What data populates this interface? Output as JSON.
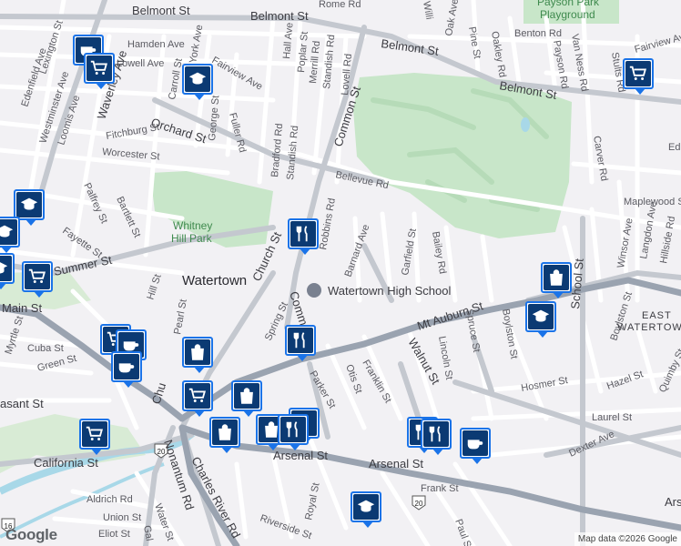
{
  "map": {
    "streets": {
      "belmont_w": "Belmont St",
      "belmont_e": "Belmont St",
      "belmont_e2": "Belmont St",
      "rome_rd": "Rome Rd",
      "hamden": "Hamden Ave",
      "york": "York Ave",
      "hall": "Hall Ave",
      "poplar": "Poplar St",
      "merrill": "Merrill Rd",
      "standish_top": "Standish Rd",
      "lovell_rd": "Lovell Rd",
      "lexington": "Lexington St",
      "edenfield": "Edenfield Ave",
      "lowell": "Lowell Ave",
      "westminster": "Westminster Ave",
      "loomis": "Loomis Ave",
      "waverley": "Waverley Ave",
      "carroll": "Carroll St",
      "fairview": "Fairview Ave",
      "george": "George St",
      "fuller": "Fuller Rd",
      "orchard": "Orchard St",
      "fitchburg": "Fitchburg St",
      "worcester": "Worcester St",
      "bradford": "Bradford Rd",
      "standish": "Standish Rd",
      "common": "Common St",
      "bellevue": "Bellevue Rd",
      "palfrey": "Palfrey St",
      "bartlett": "Bartlett St",
      "fayette": "Fayette St",
      "summer": "Summer St",
      "hill": "Hill St",
      "main": "Main St",
      "myrtle": "Myrtle St",
      "cuba": "Cuba St",
      "green": "Green St",
      "pearl": "Pearl St",
      "church": "Church St",
      "church2": "Church St",
      "spring": "Spring St",
      "common2": "Common St",
      "robbins": "Robbins Rd",
      "barnard": "Barnard Ave",
      "garfield": "Garfield St",
      "bailey": "Bailey Rd",
      "mt_auburn": "Mt Auburn St",
      "walnut": "Walnut St",
      "lincoln": "Lincoln St",
      "spruce": "Spruce St",
      "boylston": "Boylston St",
      "boylston2": "Boylston St",
      "school": "School St",
      "otis": "Otis St",
      "franklin": "Franklin St",
      "parker": "Parker St",
      "pleasant": "Pleasant St",
      "california": "California St",
      "nonantum": "Nonantum Rd",
      "charles_river": "Charles River Rd",
      "arsenal_w": "Arsenal St",
      "arsenal_e": "Arsenal St",
      "arsenal_e2": "Arsenal St",
      "frank": "Frank St",
      "aldrich": "Aldrich Rd",
      "water": "Water St",
      "union": "Union St",
      "eliot": "Eliot St",
      "royal": "Royal St",
      "riverside": "Riverside St",
      "paul": "Paul St",
      "hosmer": "Hosmer St",
      "hazel": "Hazel St",
      "laurel": "Laurel St",
      "dexter": "Dexter Ave",
      "quimby": "Quimby St",
      "carver": "Carver Rd",
      "winsor": "Winsor Ave",
      "langdon": "Langdon Ave",
      "hillside": "Hillside Rd",
      "maplewood": "Maplewood St",
      "oak": "Oak Ave",
      "pine": "Pine St",
      "oakley": "Oakley Rd",
      "benton": "Benton Rd",
      "van_ness": "Van Ness Rd",
      "payson": "Payson Rd",
      "stults": "Stults Rd",
      "fairview_e": "Fairview Ave",
      "edge_ed": "Ed",
      "will": "Willi",
      "gal": "Gal",
      "royal_st_short": "Royal St",
      "sp": "Sp",
      "chu": "Chu",
      "pleasant_short": "asant St",
      "wb": "S"
    },
    "places": {
      "town": "Watertown",
      "park": "Whitney Hill Park",
      "park_line1": "Whitney",
      "park_line2": "Hill Park",
      "payson_line1": "Payson Park",
      "payson_line2": "Playground",
      "high_school": "Watertown High School",
      "east_line1": "EAST",
      "east_line2": "WATERTOWN"
    },
    "shields": {
      "r20a": "20",
      "r20b": "20",
      "r16": "16"
    },
    "logo": "Google",
    "attribution": "Map data ©2026 Google",
    "colors": {
      "background": "#f2f1f4",
      "road_major": "#9aa3b0",
      "road_arterial": "#b7bcc4",
      "road_minor": "#ffffff",
      "park": "#c8e6c9",
      "water": "#a8d8e8",
      "marker_fill": "#0b3a73",
      "marker_border": "#1a73e8"
    }
  },
  "markers": [
    {
      "type": "coffee",
      "icon": "coffee-icon"
    },
    {
      "type": "grocery",
      "icon": "cart-icon"
    },
    {
      "type": "school",
      "icon": "school-icon"
    },
    {
      "type": "grocery",
      "icon": "cart-icon"
    },
    {
      "type": "school",
      "icon": "school-icon"
    },
    {
      "type": "school",
      "icon": "school-icon"
    },
    {
      "type": "grocery",
      "icon": "cart-icon"
    },
    {
      "type": "school",
      "icon": "school-icon"
    },
    {
      "type": "restaurant",
      "icon": "fork-knife-icon"
    },
    {
      "type": "shopping",
      "icon": "bag-icon"
    },
    {
      "type": "school",
      "icon": "school-icon"
    },
    {
      "type": "restaurant",
      "icon": "fork-knife-icon"
    },
    {
      "type": "grocery",
      "icon": "cart-icon"
    },
    {
      "type": "coffee",
      "icon": "coffee-icon"
    },
    {
      "type": "shopping",
      "icon": "bag-icon"
    },
    {
      "type": "coffee",
      "icon": "coffee-icon"
    },
    {
      "type": "grocery",
      "icon": "cart-icon"
    },
    {
      "type": "shopping",
      "icon": "bag-icon"
    },
    {
      "type": "restaurant",
      "icon": "fork-knife-icon"
    },
    {
      "type": "grocery",
      "icon": "cart-icon"
    },
    {
      "type": "shopping",
      "icon": "bag-icon"
    },
    {
      "type": "shopping",
      "icon": "bag-icon"
    },
    {
      "type": "restaurant",
      "icon": "fork-knife-icon"
    },
    {
      "type": "restaurant",
      "icon": "fork-knife-icon"
    },
    {
      "type": "restaurant",
      "icon": "fork-knife-icon"
    },
    {
      "type": "coffee",
      "icon": "coffee-icon"
    },
    {
      "type": "school",
      "icon": "school-icon"
    }
  ]
}
